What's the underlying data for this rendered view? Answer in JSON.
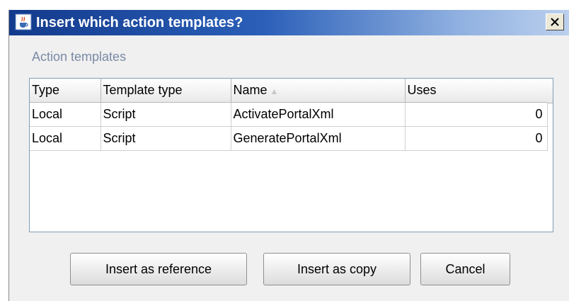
{
  "window": {
    "title": "Insert which action templates?"
  },
  "section": {
    "label": "Action templates"
  },
  "table": {
    "columns": [
      "Type",
      "Template type",
      "Name",
      "Uses"
    ],
    "sort_column": "Name",
    "rows": [
      {
        "type": "Local",
        "template_type": "Script",
        "name": "ActivatePortalXml",
        "uses": "0"
      },
      {
        "type": "Local",
        "template_type": "Script",
        "name": "GeneratePortalXml",
        "uses": "0"
      }
    ]
  },
  "buttons": {
    "insert_reference": "Insert as reference",
    "insert_copy": "Insert as copy",
    "cancel": "Cancel"
  },
  "icons": {
    "app": "java-cup-icon",
    "close": "close-icon",
    "sort": "sort-ascending-icon"
  },
  "colors": {
    "title_gradient_start": "#133a8c",
    "title_gradient_end": "#bcd0ee",
    "section_label": "#7a8aa6"
  }
}
